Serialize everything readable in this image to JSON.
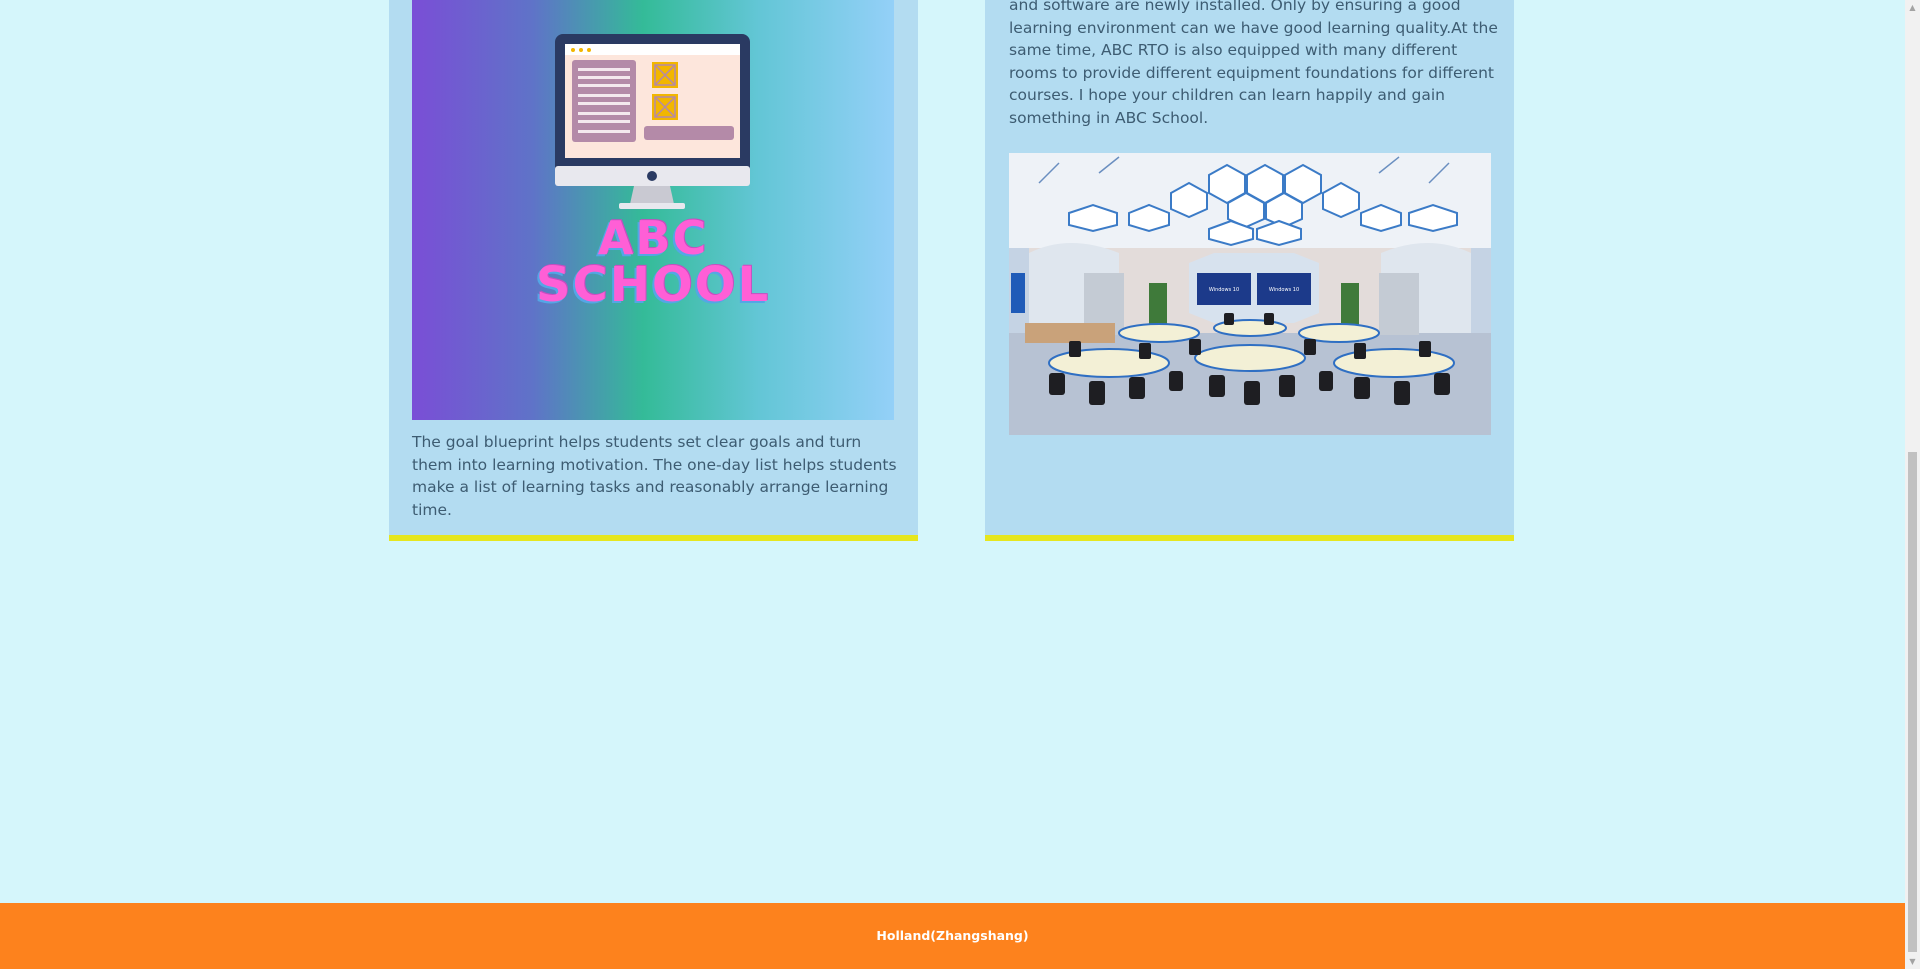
{
  "cards": {
    "left": {
      "logo_line1": "ABC",
      "logo_line2": "SCHOOL",
      "description": "The goal blueprint helps students set clear goals and turn them into learning motivation. The one-day list helps students make a list of learning tasks and reasonably arrange learning time."
    },
    "right": {
      "description": "and software are newly installed. Only by ensuring a good learning environment can we have good learning quality.At the same time, ABC RTO is also equipped with many different rooms to provide different equipment foundations for different courses. I hope your children can learn happily and gain something in ABC School.",
      "screen_label_1": "Windows 10",
      "screen_label_2": "Windows 10"
    }
  },
  "footer": {
    "text": "Holland(Zhangshang)"
  },
  "colors": {
    "page_background": "#d5f6fb",
    "card_background": "#b3dcf1",
    "card_accent_border": "#e6e61e",
    "footer_background": "#fd821d",
    "logo_text": "#ff5fd6"
  },
  "icons": {
    "logo": "computer-monitor-icon",
    "scroll_up": "scroll-up-arrow-icon",
    "scroll_down": "scroll-down-arrow-icon"
  }
}
